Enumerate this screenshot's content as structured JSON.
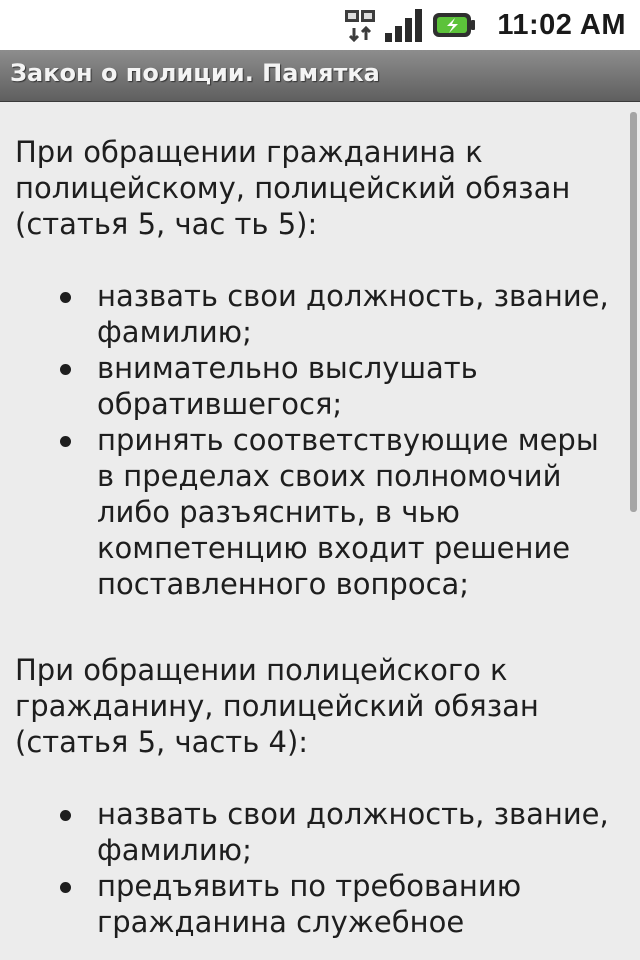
{
  "status_bar": {
    "time": "11:02 AM",
    "icons": [
      "data-sync-icon",
      "signal-icon",
      "battery-icon"
    ]
  },
  "title_bar": {
    "title": "Закон о полиции. Памятка"
  },
  "content": {
    "section1": {
      "intro": "При обращении гражданина к полицейскому, полицейский обязан (статья 5, час ть 5):",
      "items": [
        "назвать свои должность, звание, фамилию;",
        "внимательно выслушать обратившегося;",
        "принять соответствующие меры в пределах своих полномочий либо разъяснить, в чью компетенцию входит решение поставленного вопроса;"
      ]
    },
    "section2": {
      "intro": "При обращении полицейского к гражданину, полицейский обязан (статья 5, часть 4):",
      "items": [
        "назвать свои должность, звание, фамилию;",
        "предъявить по требованию гражданина служебное"
      ]
    }
  },
  "colors": {
    "background": "#ececec",
    "title_bar": "#6f6f6f",
    "text": "#1e1e1e",
    "battery_accent": "#5cc23a"
  }
}
